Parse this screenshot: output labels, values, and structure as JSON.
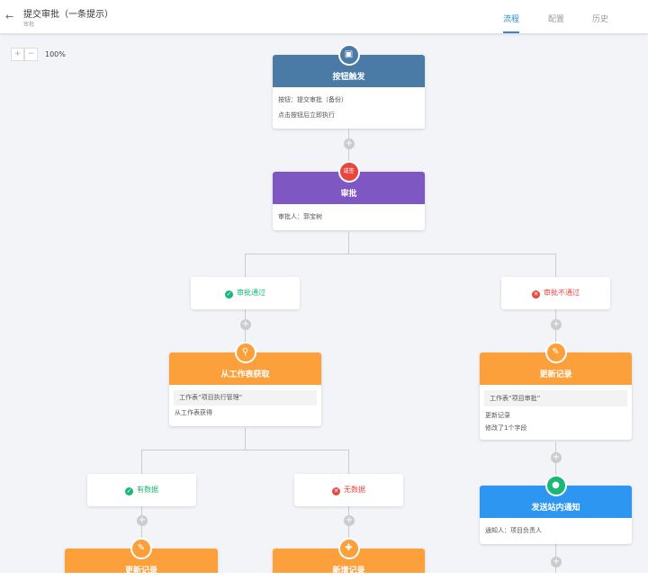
{
  "header": {
    "title": "提交审批（一条提示）",
    "subtitle": "审批",
    "tabs": [
      {
        "label": "流程"
      },
      {
        "label": "配置"
      },
      {
        "label": "历史"
      }
    ]
  },
  "zoom": {
    "plus": "+",
    "minus": "−",
    "value": "100%"
  },
  "colors": {
    "trigger": "#4a7ba6",
    "approval": "#7e57c2",
    "action": "#fca03c",
    "notify": "#2d96f0",
    "success": "#1bb776",
    "fail": "#e8463f"
  },
  "nodes": {
    "trigger": {
      "title": "按钮触发",
      "line1": "按钮：提交审批（备份）",
      "line2": "点击按钮后立即执行"
    },
    "approval": {
      "badge": "或签",
      "title": "审批",
      "line1": "审批人：郭宝树"
    },
    "pass": {
      "label": "审批通过"
    },
    "reject": {
      "label": "审批不通过"
    },
    "get": {
      "title": "从工作表获取",
      "line1": "工作表“项目执行管理”",
      "line2": "从工作表获得"
    },
    "update_right": {
      "title": "更新记录",
      "line1": "工作表“项目审批”",
      "line2": "更新记录",
      "line3": "修改了1个字段"
    },
    "notify": {
      "title": "发送站内通知",
      "line1": "通知人：项目负责人"
    },
    "has_data": {
      "label": "有数据"
    },
    "no_data": {
      "label": "无数据"
    },
    "update_left": {
      "title": "更新记录"
    },
    "add_record": {
      "title": "新增记录"
    }
  }
}
